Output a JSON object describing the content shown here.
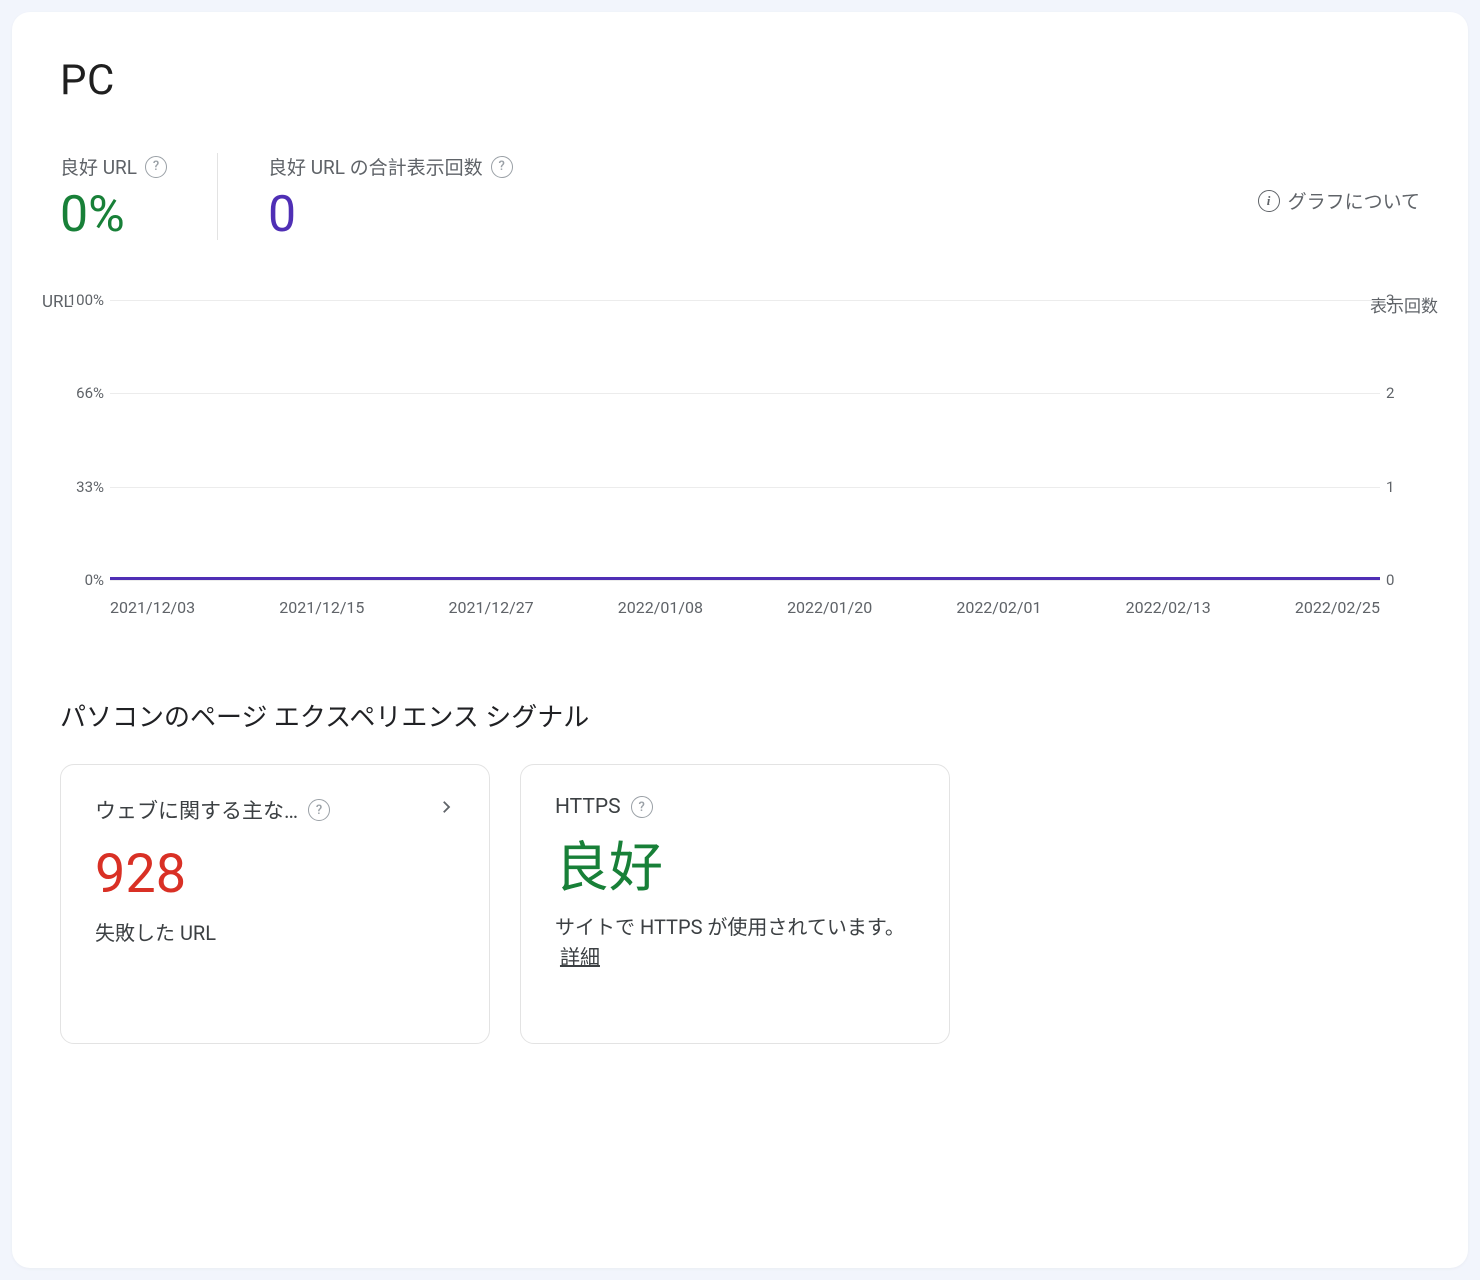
{
  "header": {
    "title": "PC"
  },
  "metrics": {
    "good_url": {
      "label": "良好 URL",
      "value": "0%"
    },
    "good_impr": {
      "label": "良好 URL の合計表示回数",
      "value": "0"
    },
    "about_link": "グラフについて"
  },
  "chart_data": {
    "type": "line",
    "left_axis_title": "URL",
    "right_axis_title": "表示回数",
    "y_left": {
      "ticks": [
        "100%",
        "66%",
        "33%",
        "0%"
      ],
      "range": [
        0,
        100
      ]
    },
    "y_right": {
      "ticks": [
        "3",
        "2",
        "1",
        "0"
      ],
      "range": [
        0,
        3
      ]
    },
    "x_ticks": [
      "2021/12/03",
      "2021/12/15",
      "2021/12/27",
      "2022/01/08",
      "2022/01/20",
      "2022/02/01",
      "2022/02/13",
      "2022/02/25"
    ],
    "series": [
      {
        "name": "良好 URL %",
        "axis": "left",
        "color": "#188038",
        "constant_value": 0
      },
      {
        "name": "表示回数",
        "axis": "right",
        "color": "#4f2fb5",
        "constant_value": 0
      }
    ]
  },
  "signals": {
    "section_title": "パソコンのページ エクスペリエンス シグナル",
    "core_web_vitals": {
      "title": "ウェブに関する主な…",
      "value": "928",
      "subtitle": "失敗した URL"
    },
    "https": {
      "title": "HTTPS",
      "value": "良好",
      "subtitle_prefix": "サイトで HTTPS が使用されています。",
      "details_label": "詳細"
    }
  }
}
